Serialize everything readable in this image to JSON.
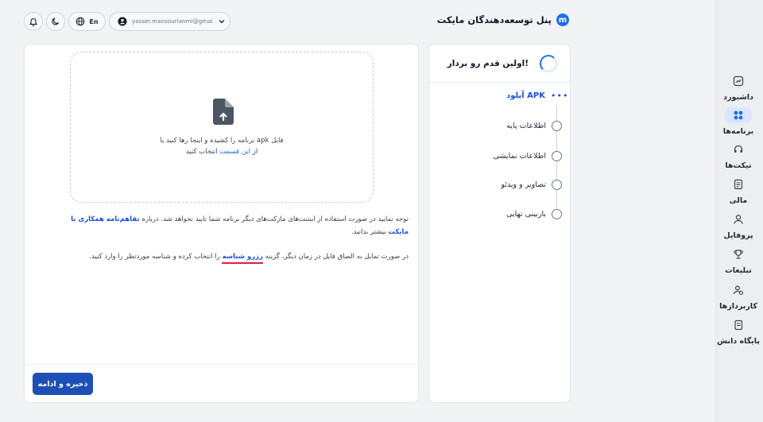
{
  "header": {
    "brand_logo": "m",
    "brand_title": "پنل توسعه‌دهندگان مایکت",
    "lang_label": "En",
    "account_email": "yasser.mansourianmi@gmail.c..."
  },
  "sidebar": {
    "items": [
      {
        "label": "داشبورد",
        "icon": "chart-icon"
      },
      {
        "label": "برنامه‌ها",
        "icon": "apps-grid-icon",
        "active": true
      },
      {
        "label": "تیکت‌ها",
        "icon": "headset-icon"
      },
      {
        "label": "مالی",
        "icon": "document-icon"
      },
      {
        "label": "پروفایل",
        "icon": "user-icon"
      },
      {
        "label": "تبلیغات",
        "icon": "trophy-icon"
      },
      {
        "label": "کاربردازها",
        "icon": "users-gear-icon"
      },
      {
        "label": "پایگاه دانش",
        "icon": "book-icon"
      }
    ]
  },
  "steps": {
    "title": "اولین قدم رو بردار!",
    "current": "آپلود APK",
    "items": [
      "اطلاعات پایه",
      "اطلاعات نمایشی",
      "تصاویر و ویدئو",
      "بازبینی نهایی"
    ]
  },
  "upload": {
    "line1": "فایل apk برنامه را کشیده و اینجا رها کنید یا",
    "line2_prefix": "از",
    "line2_link": "این قسمت",
    "line2_suffix": "انتخاب کنید"
  },
  "notice": {
    "p1_before": "توجه نمایید در صورت استفاده از اینتنت‌های مارکت‌های دیگر برنامه شما تایید نخواهد شد. درباره",
    "p1_link": "تفاهم‌نامه همکاری با مایکت",
    "p1_after": "بیشتر بدانید.",
    "p2_before": "در صورت تمایل به الصاق فایل در زمان دیگر، گزینه",
    "p2_highlight": "رزرو شناسه",
    "p2_after": "را انتخاب کرده و شناسه موردنظر را وارد کنید."
  },
  "actions": {
    "save_label": "ذخیره و ادامه"
  },
  "colors": {
    "primary": "#1e4fb5",
    "link": "#1d6ae5",
    "active_nav_bg": "#d9e6ff",
    "highlight_underline": "#e11d48"
  }
}
